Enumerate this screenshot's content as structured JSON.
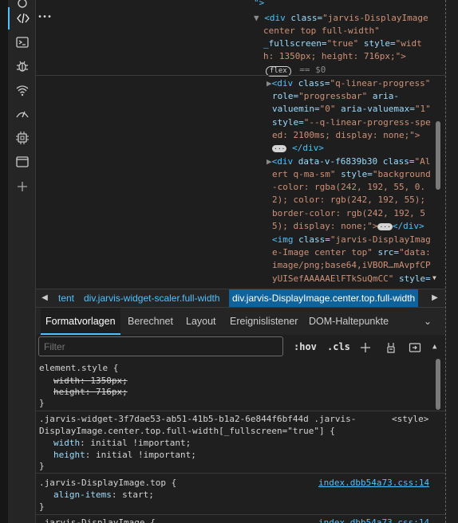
{
  "activity_bar": {
    "items": [
      {
        "name": "inspector-icon"
      },
      {
        "name": "console-icon"
      },
      {
        "name": "debugger-icon"
      },
      {
        "name": "network-icon"
      },
      {
        "name": "performance-icon"
      },
      {
        "name": "memory-icon"
      },
      {
        "name": "application-icon"
      },
      {
        "name": "add-tool-icon"
      }
    ]
  },
  "dom": {
    "top_fragment": "\">",
    "more_button": "•••",
    "lines": [
      {
        "text_tag": "<div",
        "a1": " class=",
        "v1": "\"jarvis-DisplayImage"
      },
      {
        "v1": "center top full-width\""
      },
      {
        "a1": "_fullscreen=",
        "v1": "\"true\"",
        "a2": " style=",
        "v2": "\"widt"
      },
      {
        "v1": "h: 1350px; height: 716px;\">"
      },
      {
        "badge": "flex",
        "eq": " == $0"
      },
      {
        "text_tag": "<div",
        "a1": " class=",
        "v1": "\"q-linear-progress\""
      },
      {
        "a1": "role=",
        "v1": "\"progressbar\"",
        "a2": " aria-"
      },
      {
        "a1": "valuemin=",
        "v1": "\"0\"",
        "a2": " aria-valuemax=",
        "v2": "\"1\""
      },
      {
        "a1": "style=",
        "v1": "\"--q-linear-progress-spe"
      },
      {
        "v1": "ed: 2100ms; display: none;\">"
      },
      {
        "ellipsis": "···",
        "close": " </div>"
      },
      {
        "text_tag": "<div",
        "a1": " data-v-f6839b30 class=",
        "v1": "\"Al"
      },
      {
        "v1": "ert q-ma-sm\"",
        "a2": " style=",
        "v2": "\"background"
      },
      {
        "v1": "-color: rgba(242, 192, 55, 0."
      },
      {
        "v1": "2); color: rgb(242, 192, 55);"
      },
      {
        "v1": "border-color: rgb(242, 192, 5"
      },
      {
        "v1": "5); display: none;\">",
        "ellipsis": "···",
        "close": "</div>"
      },
      {
        "text_tag": "<img",
        "a1": " class=",
        "v1": "\"jarvis-DisplayImag"
      },
      {
        "v1": "e-Image center top\"",
        "a2": " src=",
        "v2": "\"data:"
      },
      {
        "v1": "image/png;base64,iVBOR…mAvpfCP"
      },
      {
        "v1": "yUISefAAAAAElFTkSuQmCC\"",
        "a2": " style="
      }
    ]
  },
  "breadcrumbs": {
    "left_arrow": "◀",
    "right_arrow": "▶",
    "items": [
      "tent",
      "div.jarvis-widget-scaler.full-width",
      "div.jarvis-DisplayImage.center.top.full-width"
    ]
  },
  "tabs": [
    "Formatvorlagen",
    "Berechnet",
    "Layout",
    "Ereignislistener",
    "DOM-Haltepunkte"
  ],
  "filter": {
    "placeholder": "Filter",
    "hov": ":hov",
    "cls": ".cls"
  },
  "rules": [
    {
      "selector": "element.style {",
      "decls": [
        {
          "p": "width",
          "v": "1350px;",
          "struck": true
        },
        {
          "p": "height",
          "v": "716px;",
          "struck": true
        }
      ],
      "close": "}"
    },
    {
      "selector": ".jarvis-widget-3f7dae53-ab51-41b5-b1a2-6e844f6bf44d .jarvis-",
      "selector2": "DisplayImage.center.top.full-width[_fullscreen=\"true\"] {",
      "source": "<style>",
      "decls": [
        {
          "p": "width",
          "v": "initial !important;"
        },
        {
          "p": "height",
          "v": "initial !important;"
        }
      ],
      "close": "}"
    },
    {
      "selector": ".jarvis-DisplayImage.top {",
      "source": "index.dbb54a73.css:14",
      "decls": [
        {
          "p": "align-items",
          "v": "start;"
        }
      ],
      "close": "}"
    },
    {
      "selector": ".jarvis-DisplayImage {",
      "source": "index.dbb54a73.css:14"
    }
  ]
}
